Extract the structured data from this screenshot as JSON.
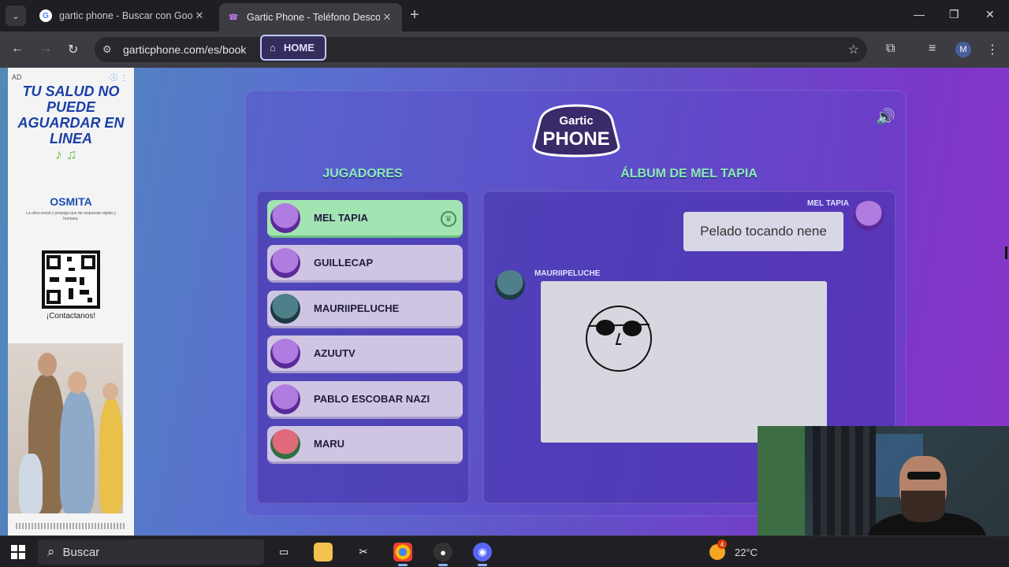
{
  "browser": {
    "tabs": [
      {
        "title": "gartic phone - Buscar con Goo",
        "close": "✕"
      },
      {
        "title": "Gartic Phone - Teléfono Descor",
        "close": "✕"
      }
    ],
    "new_tab": "+",
    "url": "garticphone.com/es/book",
    "profile_initial": "M"
  },
  "ad": {
    "label": "AD",
    "headline": "TU SALUD NO PUEDE AGUARDAR EN LINEA",
    "brand": "OSMITA",
    "tagline": "La obra social y prepaga que da respuesta rápida y humana.",
    "cta": "¡Contactanos!"
  },
  "game": {
    "home_label": "HOME",
    "logo_top": "Gartic",
    "logo_bottom": "PHONE",
    "players_heading": "JUGADORES",
    "album_heading": "ÁLBUM DE MEL TAPIA",
    "players": [
      {
        "name": "MEL TAPIA",
        "active": true,
        "host": true
      },
      {
        "name": "GUILLECAP",
        "active": false
      },
      {
        "name": "MAURIIPELUCHE",
        "active": false
      },
      {
        "name": "AZUUTV",
        "active": false
      },
      {
        "name": "PABLO ESCOBAR NAZI",
        "active": false
      },
      {
        "name": "MARU",
        "active": false
      }
    ],
    "album": [
      {
        "author": "MEL TAPIA",
        "type": "text",
        "text": "Pelado tocando nene"
      },
      {
        "author": "MAURIIPELUCHE",
        "type": "drawing"
      }
    ]
  },
  "taskbar": {
    "search_placeholder": "Buscar",
    "weather_temp": "22°C",
    "weather_badge": "4"
  },
  "colors": {
    "accent_green": "#8ce8b5",
    "player_active": "#a3e4b3",
    "player_idle": "#cfc5e3"
  }
}
